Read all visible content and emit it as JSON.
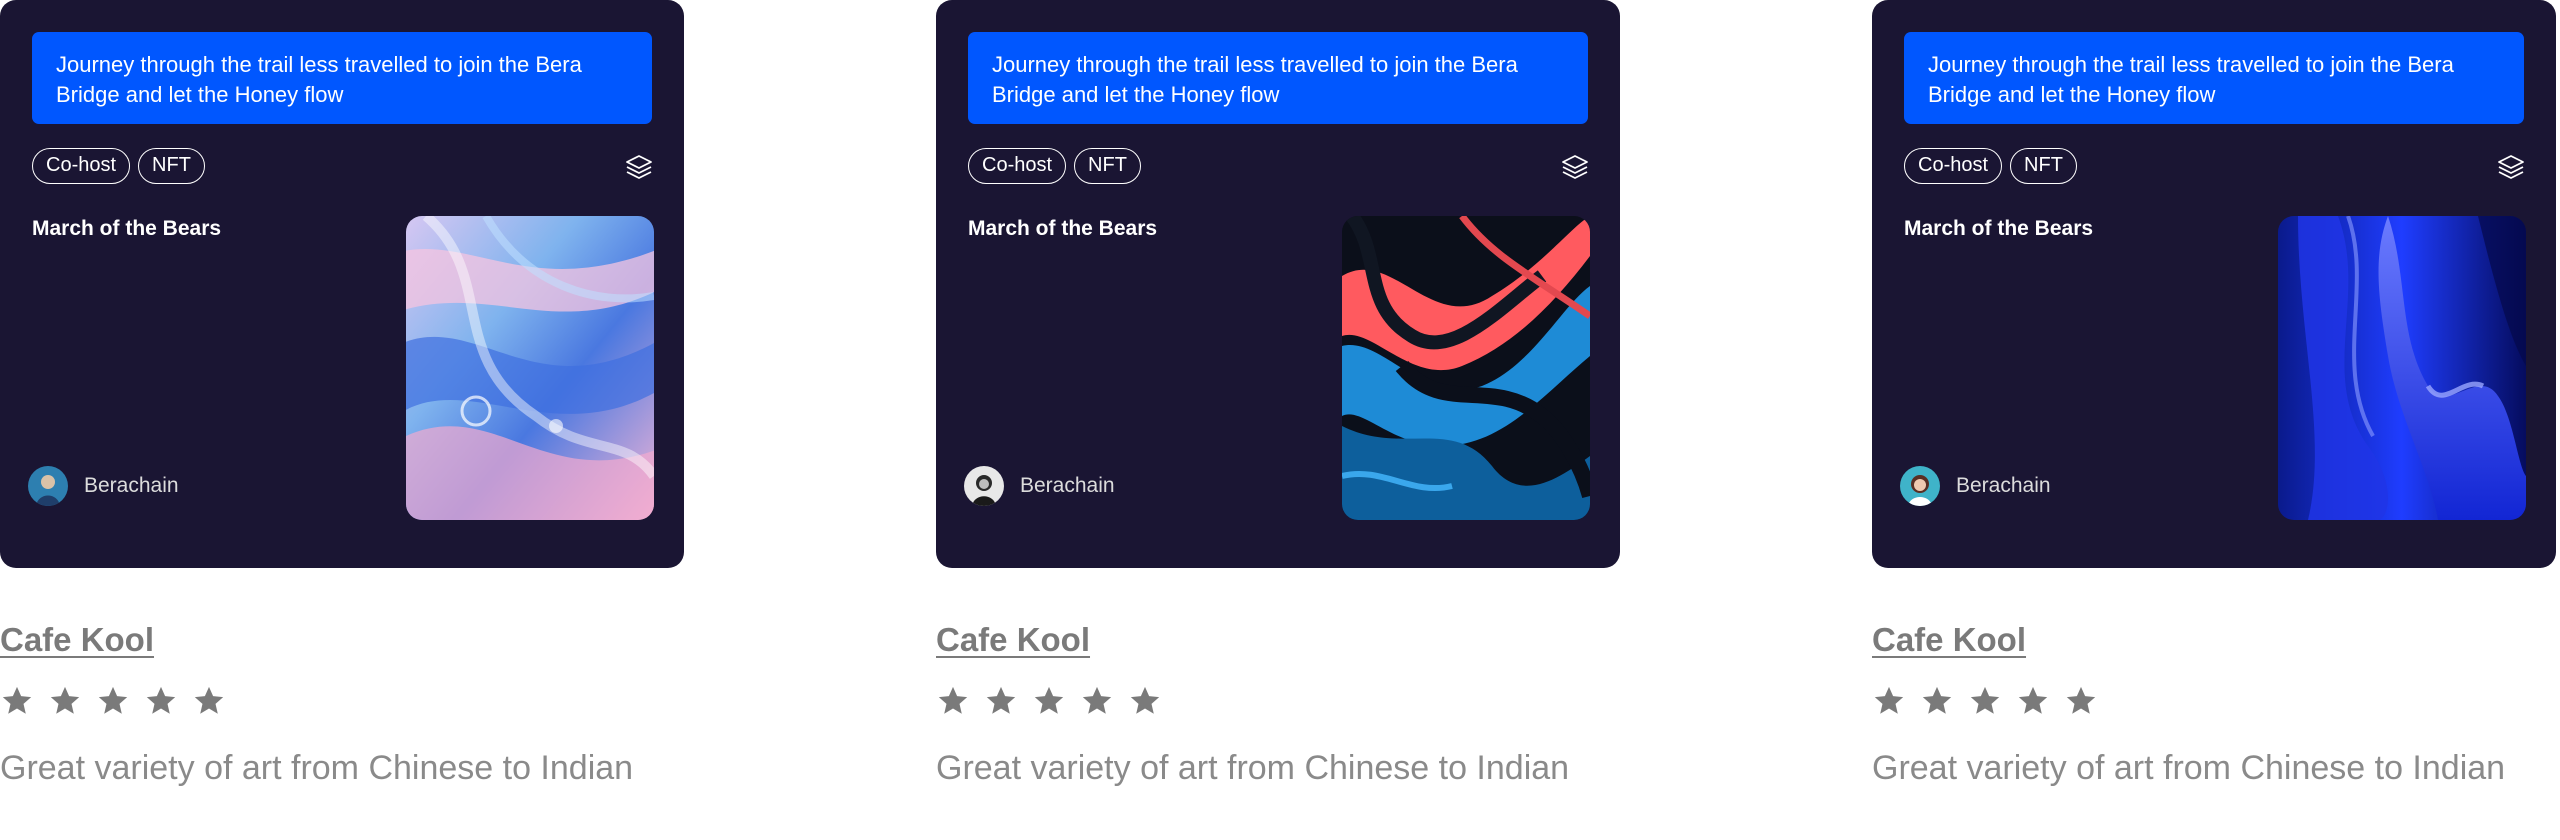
{
  "cards": [
    {
      "banner_text": "Journey through the trail less travelled to join the Bera Bridge and let the Honey flow",
      "tags": [
        "Co-host",
        "NFT"
      ],
      "layers_icon": "layers-icon",
      "event_title": "March of the Bears",
      "host_name": "Berachain",
      "venue": "Cafe Kool",
      "rating": 5,
      "review": "Great variety of art from Chinese to Indian"
    },
    {
      "banner_text": "Journey through the trail less travelled to join the Bera Bridge and let the Honey flow",
      "tags": [
        "Co-host",
        "NFT"
      ],
      "layers_icon": "layers-icon",
      "event_title": "March of the Bears",
      "host_name": "Berachain",
      "venue": "Cafe Kool",
      "rating": 5,
      "review": "Great variety of art from Chinese to Indian"
    },
    {
      "banner_text": "Journey through the trail less travelled to join the Bera Bridge and let the Honey flow",
      "tags": [
        "Co-host",
        "NFT"
      ],
      "layers_icon": "layers-icon",
      "event_title": "March of the Bears",
      "host_name": "Berachain",
      "venue": "Cafe Kool",
      "rating": 5,
      "review": "Great variety of art from Chinese to Indian"
    }
  ],
  "colors": {
    "card_background": "#1a1533",
    "banner_blue": "#0057ff",
    "venue_text": "#7a7a7a",
    "star": "#7a7a7a",
    "review_text": "#8a8a8a"
  }
}
